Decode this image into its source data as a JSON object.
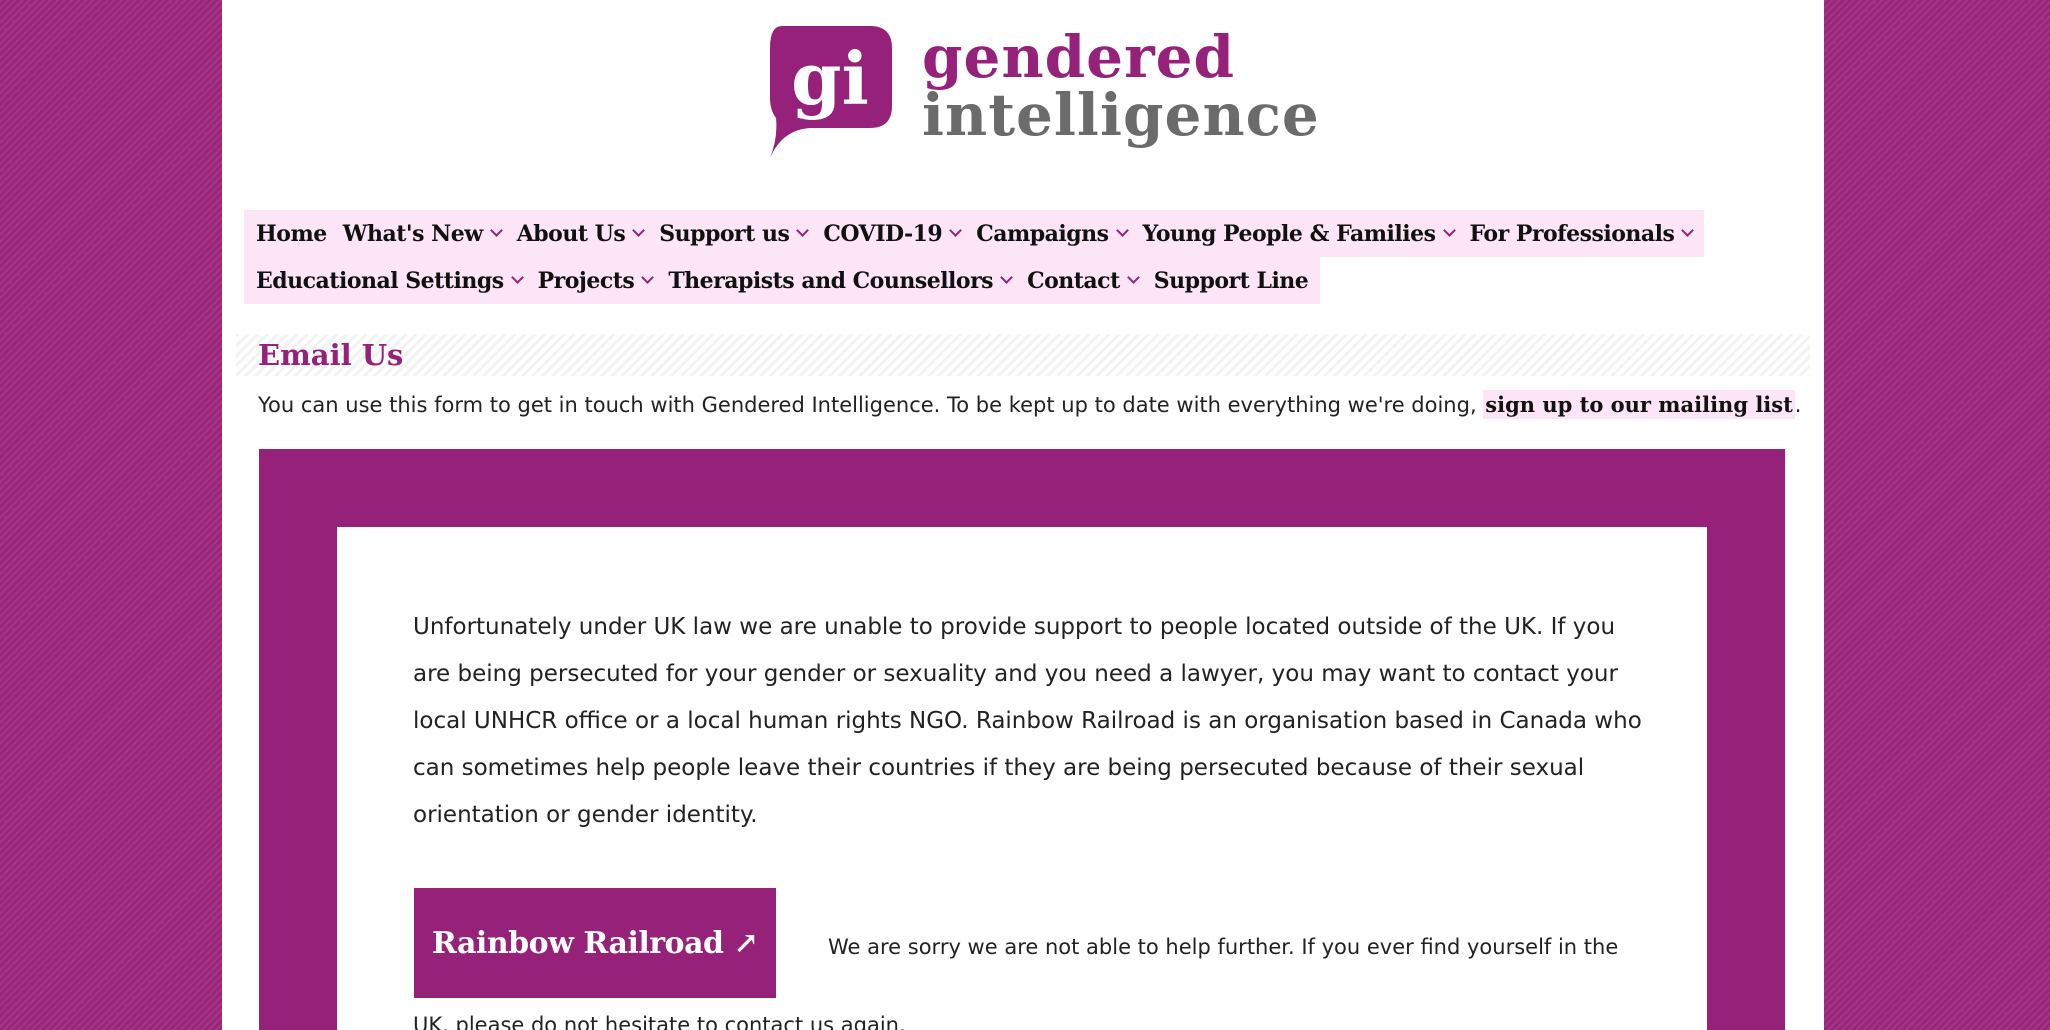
{
  "logo": {
    "mark_text": "gi",
    "word_top": "gendered",
    "word_bottom": "intelligence",
    "brand_color": "#96217a",
    "grey_color": "#6b6b6b"
  },
  "nav": {
    "row1": [
      {
        "label": "Home",
        "dropdown": false
      },
      {
        "label": "What's New",
        "dropdown": true
      },
      {
        "label": "About Us",
        "dropdown": true
      },
      {
        "label": "Support us",
        "dropdown": true
      },
      {
        "label": "COVID-19",
        "dropdown": true
      },
      {
        "label": "Campaigns",
        "dropdown": true
      },
      {
        "label": "Young People & Families",
        "dropdown": true
      },
      {
        "label": "For Professionals",
        "dropdown": true
      }
    ],
    "row2": [
      {
        "label": "Educational Settings",
        "dropdown": true
      },
      {
        "label": "Projects",
        "dropdown": true
      },
      {
        "label": "Therapists and Counsellors",
        "dropdown": true
      },
      {
        "label": "Contact",
        "dropdown": true
      },
      {
        "label": "Support Line",
        "dropdown": false
      }
    ],
    "background": "#fbe5f6"
  },
  "main": {
    "heading": "Email Us",
    "intro_text": "You can use this form to get in touch with Gendered Intelligence. To be kept up to date with everything we're doing, ",
    "intro_link": "sign up to our mailing list",
    "intro_end": "."
  },
  "notice": {
    "text": "Unfortunately under UK law we are unable to provide support to people located outside of the UK. If you are being persecuted for your gender or sexuality and you need a lawyer, you may want to contact your local UNHCR office or a local human rights NGO. Rainbow Railroad is an organisation based in Canada who can sometimes help people leave their countries if they are being persecuted because of their sexual orientation or gender identity.",
    "button_label": "Rainbow Railroad",
    "button_arrow": "↗",
    "sorry_line1": "We are sorry we are not able to help further. If you ever find yourself in the",
    "sorry_line2": "UK, please do not hesitate to contact us again."
  }
}
